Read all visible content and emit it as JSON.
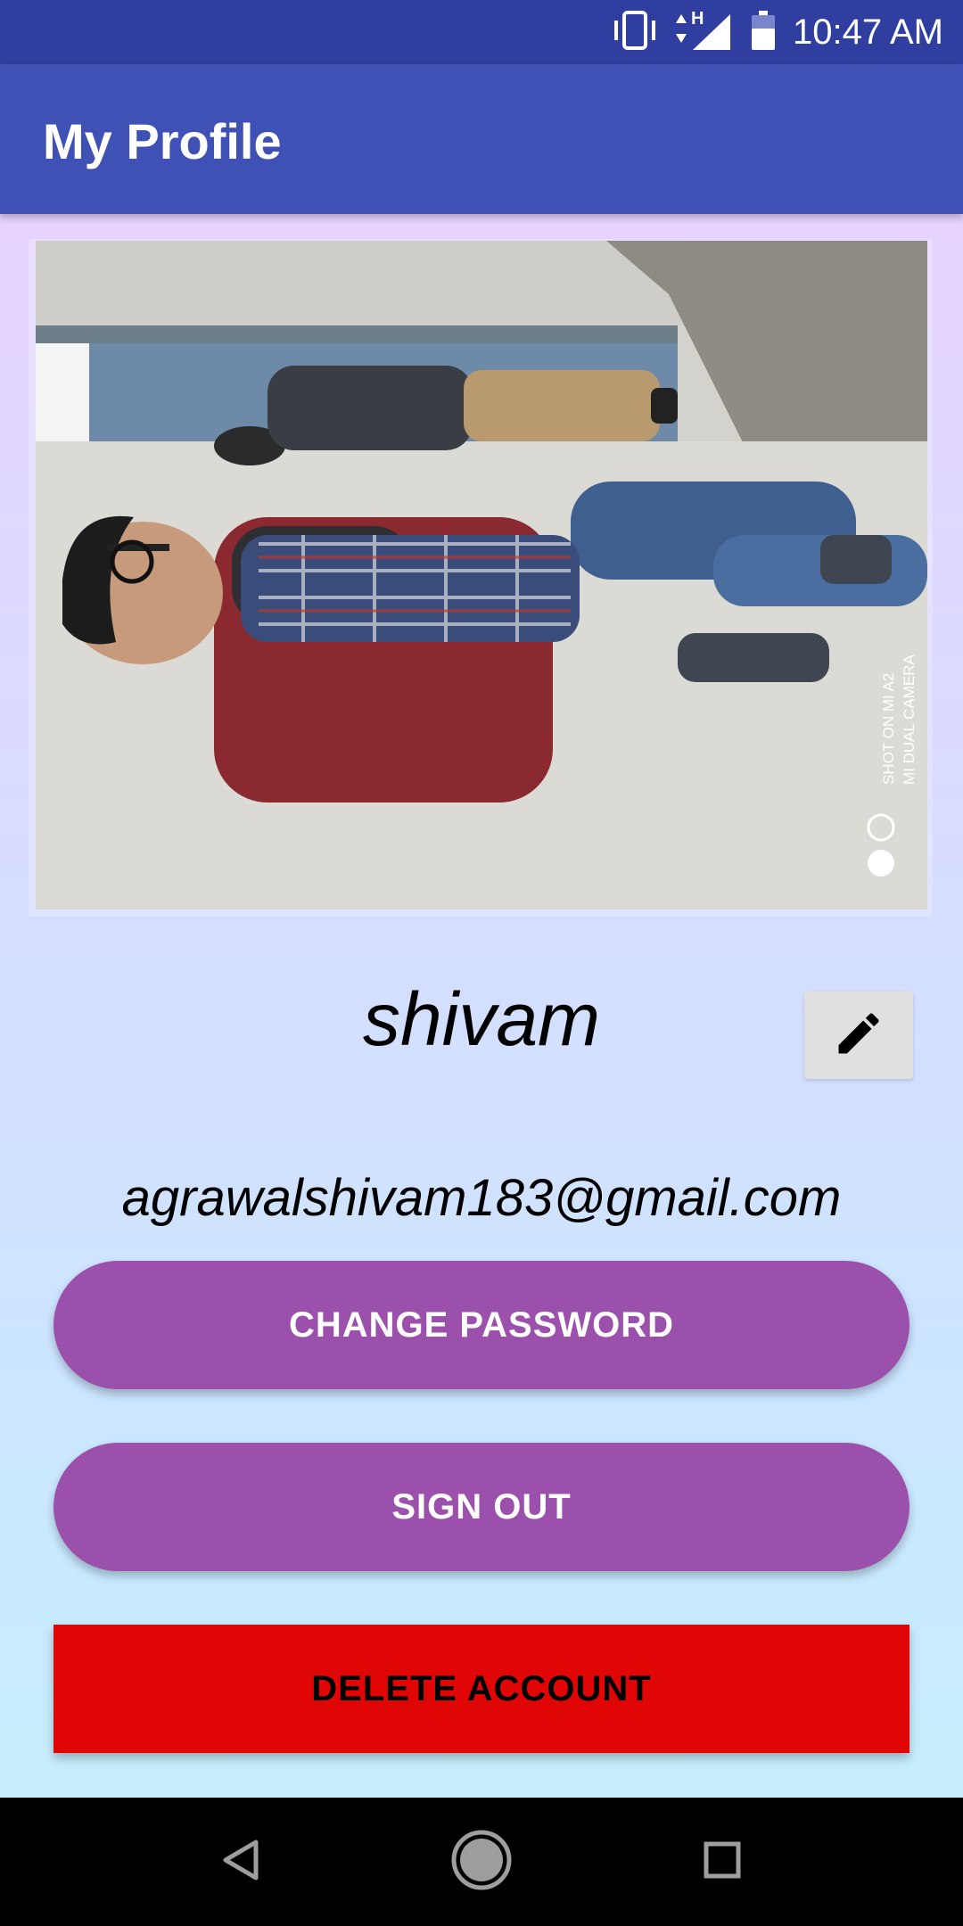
{
  "status_bar": {
    "time": "10:47 AM",
    "network_label": "H",
    "icons": [
      "vibrate-icon",
      "signal-icon",
      "battery-icon"
    ]
  },
  "app_bar": {
    "title": "My Profile"
  },
  "profile": {
    "photo_watermark_line1": "SHOT ON MI A2",
    "photo_watermark_line2": "MI DUAL CAMERA",
    "name": "shivam",
    "email": "agrawalshivam183@gmail.com",
    "edit_icon": "pencil-icon"
  },
  "actions": {
    "change_password_label": "CHANGE PASSWORD",
    "sign_out_label": "SIGN OUT",
    "delete_account_label": "DELETE ACCOUNT"
  },
  "colors": {
    "status_bar": "#303f9f",
    "app_bar": "#3f51b5",
    "primary_button": "#9b51ac",
    "delete_button": "#e10606"
  },
  "nav_bar": {
    "icons": [
      "back-icon",
      "home-icon",
      "recents-icon"
    ]
  }
}
